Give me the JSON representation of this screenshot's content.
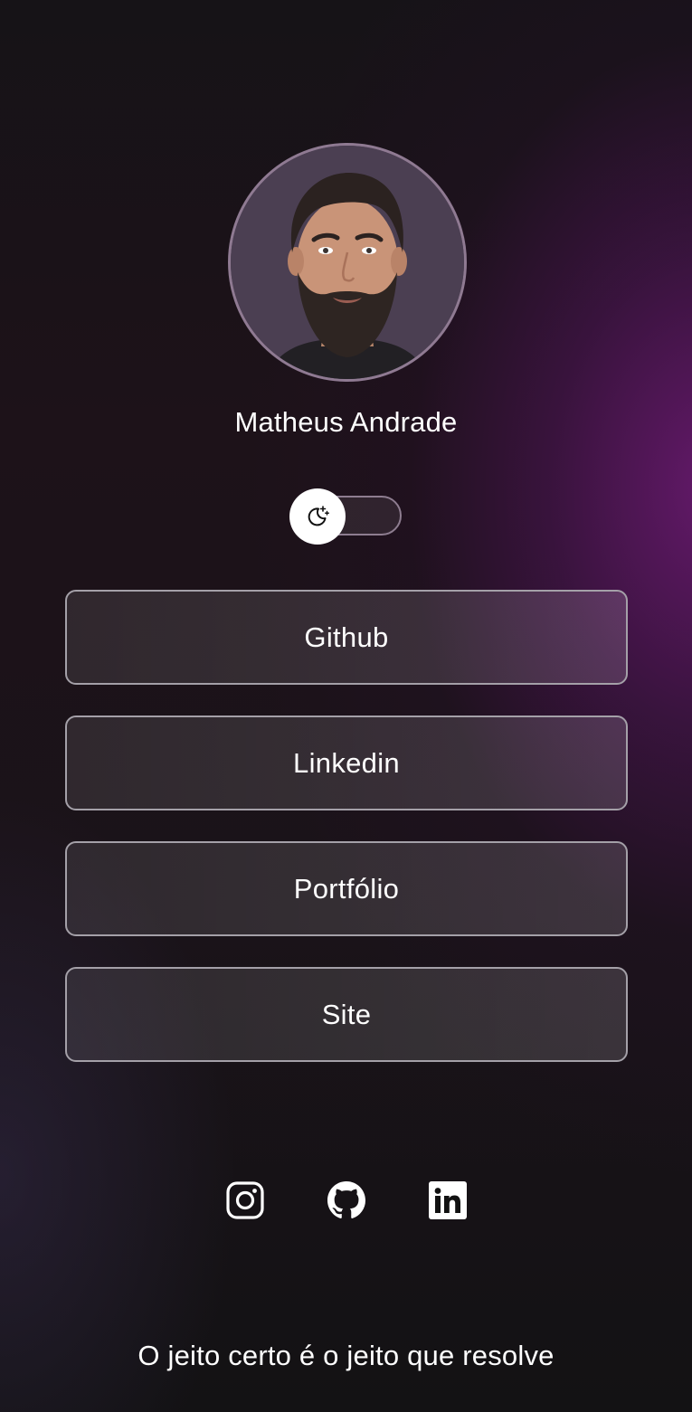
{
  "profile": {
    "name": "Matheus Andrade",
    "avatar_icon": "profile-photo"
  },
  "theme_toggle": {
    "icon": "moon-stars-icon",
    "state": "dark"
  },
  "links": [
    {
      "label": "Github"
    },
    {
      "label": "Linkedin"
    },
    {
      "label": "Portfólio"
    },
    {
      "label": "Site"
    }
  ],
  "social": [
    {
      "icon": "instagram-icon"
    },
    {
      "icon": "github-icon"
    },
    {
      "icon": "linkedin-icon"
    }
  ],
  "footer": {
    "quote": "O jeito certo é o jeito que resolve"
  },
  "colors": {
    "background": "#161317",
    "accent_glow": "#701a78",
    "button_border": "#a4a0a8",
    "text": "#ffffff"
  }
}
